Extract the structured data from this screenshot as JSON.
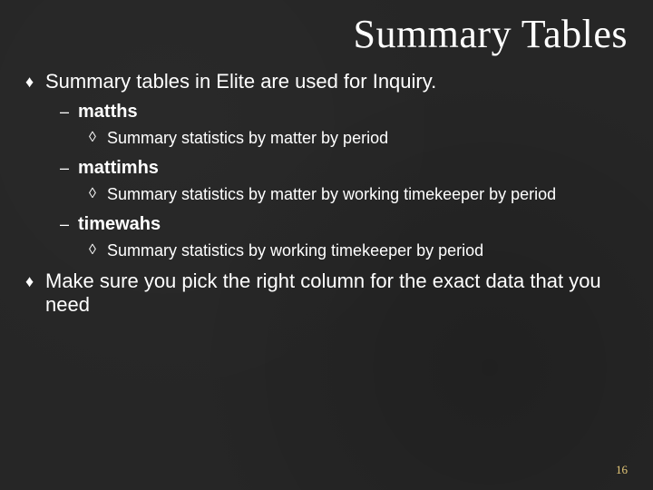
{
  "title": "Summary Tables",
  "items": [
    {
      "bullet": "♦",
      "text": "Summary tables in Elite are used for Inquiry.",
      "children": [
        {
          "bullet": "–",
          "text": "matths",
          "children": [
            {
              "bullet": "◊",
              "text": "Summary statistics by matter by period"
            }
          ]
        },
        {
          "bullet": "–",
          "text": "mattimhs",
          "children": [
            {
              "bullet": "◊",
              "text": "Summary statistics by matter by working timekeeper by period"
            }
          ]
        },
        {
          "bullet": "–",
          "text": "timewahs",
          "children": [
            {
              "bullet": "◊",
              "text": "Summary statistics by working timekeeper by period"
            }
          ]
        }
      ]
    },
    {
      "bullet": "♦",
      "text": "Make sure you pick the right column for the exact data that you need"
    }
  ],
  "page_number": "16"
}
